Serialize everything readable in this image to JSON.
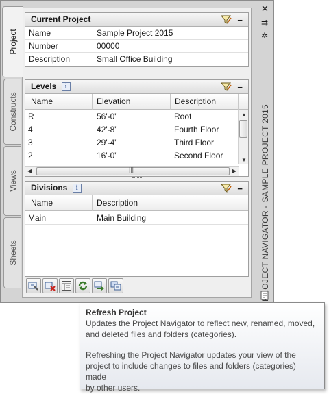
{
  "tabs": [
    {
      "label": "Project",
      "active": true
    },
    {
      "label": "Constructs",
      "active": false
    },
    {
      "label": "Views",
      "active": false
    },
    {
      "label": "Sheets",
      "active": false
    }
  ],
  "current_project": {
    "title": "Current Project",
    "rows": [
      {
        "label": "Name",
        "value": "Sample Project 2015"
      },
      {
        "label": "Number",
        "value": "00000"
      },
      {
        "label": "Description",
        "value": "Small Office Building"
      }
    ]
  },
  "levels": {
    "title": "Levels",
    "columns": [
      "Name",
      "Elevation",
      "Description"
    ],
    "rows": [
      {
        "name": "R",
        "elevation": "56'-0\"",
        "description": "Roof"
      },
      {
        "name": "4",
        "elevation": "42'-8\"",
        "description": "Fourth Floor"
      },
      {
        "name": "3",
        "elevation": "29'-4\"",
        "description": "Third Floor"
      },
      {
        "name": "2",
        "elevation": "16'-0\"",
        "description": "Second Floor"
      }
    ]
  },
  "divisions": {
    "title": "Divisions",
    "columns": [
      "Name",
      "Description"
    ],
    "rows": [
      {
        "name": "Main",
        "description": "Main Building"
      }
    ]
  },
  "side_title": "PROJECT NAVIGATOR - SAMPLE PROJECT 2015",
  "toolbar_icons": [
    "project-browser-icon",
    "close-project-icon",
    "project-properties-icon",
    "refresh-project-icon",
    "repath-project-icon",
    "synchronize-project-icon"
  ],
  "tooltip": {
    "title": "Refresh Project",
    "line1": "Updates the Project Navigator to reflect new, renamed, moved,",
    "line2": "and deleted files and folders (categories).",
    "line3": "Refreshing the Project Navigator updates your view of the",
    "line4": "project to include changes to files and folders (categories) made",
    "line5": "by other users."
  },
  "colors": {
    "accent": "#3a7a2a",
    "panel_bg": "#d4d4d4"
  }
}
